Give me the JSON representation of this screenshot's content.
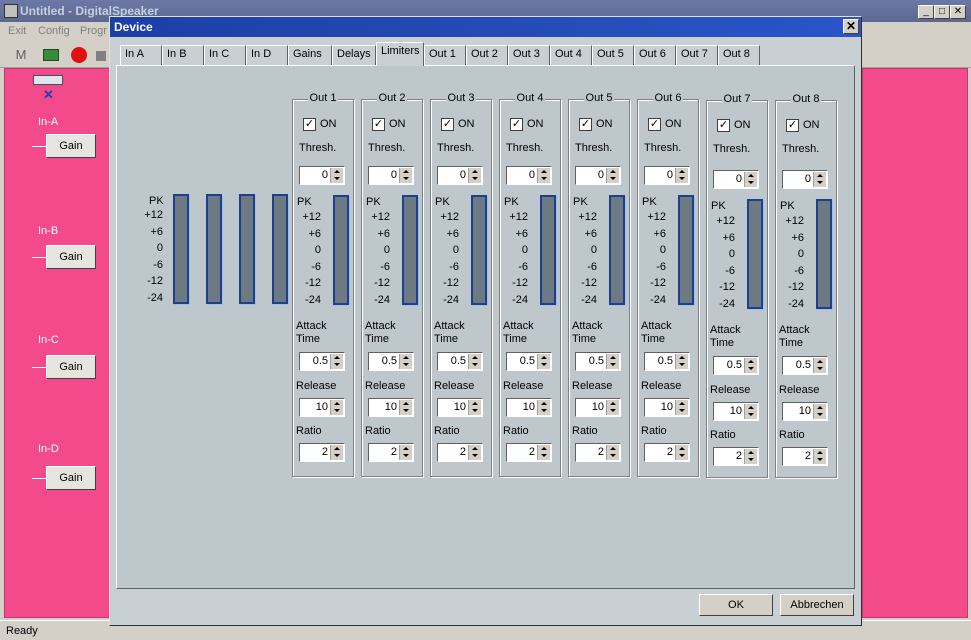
{
  "main": {
    "title": "Untitled - DigitalSpeaker",
    "menu": [
      "Exit",
      "Config",
      "Progr"
    ],
    "toolbar_label": "M",
    "inputs": [
      {
        "label": "In-A",
        "button": "Gain"
      },
      {
        "label": "In-B",
        "button": "Gain"
      },
      {
        "label": "In-C",
        "button": "Gain"
      },
      {
        "label": "In-D",
        "button": "Gain"
      }
    ],
    "status": "Ready",
    "colors": {
      "canvas": "#f24a8b",
      "titlebar": "#5c6890"
    }
  },
  "dialog": {
    "title": "Device",
    "close_glyph": "✕",
    "tabs": [
      "In A",
      "In B",
      "In C",
      "In D",
      "Gains",
      "Delays",
      "Limiters",
      "Out 1",
      "Out 2",
      "Out 3",
      "Out 4",
      "Out 5",
      "Out 6",
      "Out 7",
      "Out 8"
    ],
    "active_tab": "Limiters",
    "input_scale": {
      "pk": "PK",
      "ticks": [
        "+12",
        "+6",
        "0",
        "-6",
        "-12",
        "-24"
      ]
    },
    "labels": {
      "on": "ON",
      "thresh": "Thresh.",
      "pk": "PK",
      "attack1": "Attack",
      "attack2": "Time",
      "release": "Release",
      "ratio": "Ratio"
    },
    "outputs": [
      {
        "name": "Out 1",
        "on": true,
        "thresh": "0",
        "attack": "0.5",
        "release": "10",
        "ratio": "2"
      },
      {
        "name": "Out 2",
        "on": true,
        "thresh": "0",
        "attack": "0.5",
        "release": "10",
        "ratio": "2"
      },
      {
        "name": "Out 3",
        "on": true,
        "thresh": "0",
        "attack": "0.5",
        "release": "10",
        "ratio": "2"
      },
      {
        "name": "Out 4",
        "on": true,
        "thresh": "0",
        "attack": "0.5",
        "release": "10",
        "ratio": "2"
      },
      {
        "name": "Out 5",
        "on": true,
        "thresh": "0",
        "attack": "0.5",
        "release": "10",
        "ratio": "2"
      },
      {
        "name": "Out 6",
        "on": true,
        "thresh": "0",
        "attack": "0.5",
        "release": "10",
        "ratio": "2"
      },
      {
        "name": "Out 7",
        "on": true,
        "thresh": "0",
        "attack": "0.5",
        "release": "10",
        "ratio": "2"
      },
      {
        "name": "Out 8",
        "on": true,
        "thresh": "0",
        "attack": "0.5",
        "release": "10",
        "ratio": "2"
      }
    ],
    "ok_label": "OK",
    "cancel_label": "Abbrechen",
    "colors": {
      "title": "#1c3fa6",
      "meter_border": "#1e3f8a",
      "panel": "#bec8cc"
    }
  }
}
